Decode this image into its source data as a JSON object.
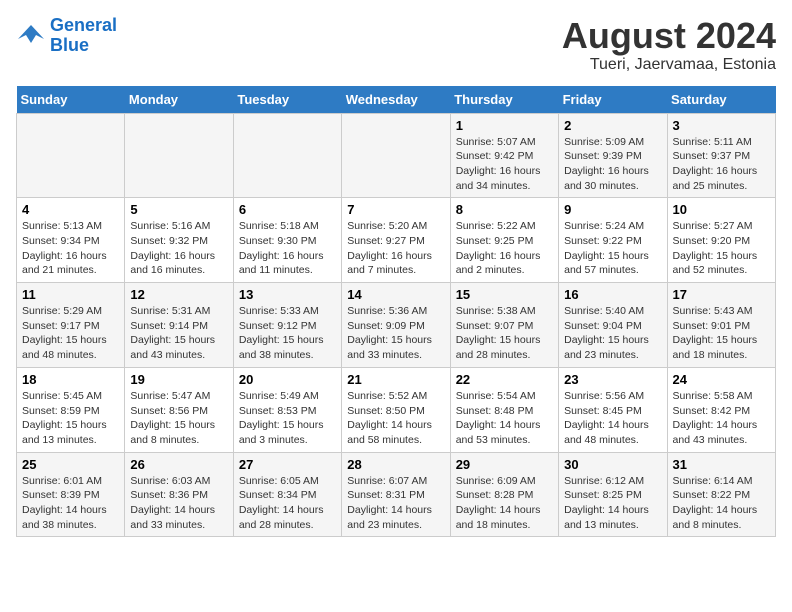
{
  "header": {
    "logo_line1": "General",
    "logo_line2": "Blue",
    "title": "August 2024",
    "subtitle": "Tueri, Jaervamaa, Estonia"
  },
  "weekdays": [
    "Sunday",
    "Monday",
    "Tuesday",
    "Wednesday",
    "Thursday",
    "Friday",
    "Saturday"
  ],
  "weeks": [
    [
      {
        "day": "",
        "info": ""
      },
      {
        "day": "",
        "info": ""
      },
      {
        "day": "",
        "info": ""
      },
      {
        "day": "",
        "info": ""
      },
      {
        "day": "1",
        "info": "Sunrise: 5:07 AM\nSunset: 9:42 PM\nDaylight: 16 hours\nand 34 minutes."
      },
      {
        "day": "2",
        "info": "Sunrise: 5:09 AM\nSunset: 9:39 PM\nDaylight: 16 hours\nand 30 minutes."
      },
      {
        "day": "3",
        "info": "Sunrise: 5:11 AM\nSunset: 9:37 PM\nDaylight: 16 hours\nand 25 minutes."
      }
    ],
    [
      {
        "day": "4",
        "info": "Sunrise: 5:13 AM\nSunset: 9:34 PM\nDaylight: 16 hours\nand 21 minutes."
      },
      {
        "day": "5",
        "info": "Sunrise: 5:16 AM\nSunset: 9:32 PM\nDaylight: 16 hours\nand 16 minutes."
      },
      {
        "day": "6",
        "info": "Sunrise: 5:18 AM\nSunset: 9:30 PM\nDaylight: 16 hours\nand 11 minutes."
      },
      {
        "day": "7",
        "info": "Sunrise: 5:20 AM\nSunset: 9:27 PM\nDaylight: 16 hours\nand 7 minutes."
      },
      {
        "day": "8",
        "info": "Sunrise: 5:22 AM\nSunset: 9:25 PM\nDaylight: 16 hours\nand 2 minutes."
      },
      {
        "day": "9",
        "info": "Sunrise: 5:24 AM\nSunset: 9:22 PM\nDaylight: 15 hours\nand 57 minutes."
      },
      {
        "day": "10",
        "info": "Sunrise: 5:27 AM\nSunset: 9:20 PM\nDaylight: 15 hours\nand 52 minutes."
      }
    ],
    [
      {
        "day": "11",
        "info": "Sunrise: 5:29 AM\nSunset: 9:17 PM\nDaylight: 15 hours\nand 48 minutes."
      },
      {
        "day": "12",
        "info": "Sunrise: 5:31 AM\nSunset: 9:14 PM\nDaylight: 15 hours\nand 43 minutes."
      },
      {
        "day": "13",
        "info": "Sunrise: 5:33 AM\nSunset: 9:12 PM\nDaylight: 15 hours\nand 38 minutes."
      },
      {
        "day": "14",
        "info": "Sunrise: 5:36 AM\nSunset: 9:09 PM\nDaylight: 15 hours\nand 33 minutes."
      },
      {
        "day": "15",
        "info": "Sunrise: 5:38 AM\nSunset: 9:07 PM\nDaylight: 15 hours\nand 28 minutes."
      },
      {
        "day": "16",
        "info": "Sunrise: 5:40 AM\nSunset: 9:04 PM\nDaylight: 15 hours\nand 23 minutes."
      },
      {
        "day": "17",
        "info": "Sunrise: 5:43 AM\nSunset: 9:01 PM\nDaylight: 15 hours\nand 18 minutes."
      }
    ],
    [
      {
        "day": "18",
        "info": "Sunrise: 5:45 AM\nSunset: 8:59 PM\nDaylight: 15 hours\nand 13 minutes."
      },
      {
        "day": "19",
        "info": "Sunrise: 5:47 AM\nSunset: 8:56 PM\nDaylight: 15 hours\nand 8 minutes."
      },
      {
        "day": "20",
        "info": "Sunrise: 5:49 AM\nSunset: 8:53 PM\nDaylight: 15 hours\nand 3 minutes."
      },
      {
        "day": "21",
        "info": "Sunrise: 5:52 AM\nSunset: 8:50 PM\nDaylight: 14 hours\nand 58 minutes."
      },
      {
        "day": "22",
        "info": "Sunrise: 5:54 AM\nSunset: 8:48 PM\nDaylight: 14 hours\nand 53 minutes."
      },
      {
        "day": "23",
        "info": "Sunrise: 5:56 AM\nSunset: 8:45 PM\nDaylight: 14 hours\nand 48 minutes."
      },
      {
        "day": "24",
        "info": "Sunrise: 5:58 AM\nSunset: 8:42 PM\nDaylight: 14 hours\nand 43 minutes."
      }
    ],
    [
      {
        "day": "25",
        "info": "Sunrise: 6:01 AM\nSunset: 8:39 PM\nDaylight: 14 hours\nand 38 minutes."
      },
      {
        "day": "26",
        "info": "Sunrise: 6:03 AM\nSunset: 8:36 PM\nDaylight: 14 hours\nand 33 minutes."
      },
      {
        "day": "27",
        "info": "Sunrise: 6:05 AM\nSunset: 8:34 PM\nDaylight: 14 hours\nand 28 minutes."
      },
      {
        "day": "28",
        "info": "Sunrise: 6:07 AM\nSunset: 8:31 PM\nDaylight: 14 hours\nand 23 minutes."
      },
      {
        "day": "29",
        "info": "Sunrise: 6:09 AM\nSunset: 8:28 PM\nDaylight: 14 hours\nand 18 minutes."
      },
      {
        "day": "30",
        "info": "Sunrise: 6:12 AM\nSunset: 8:25 PM\nDaylight: 14 hours\nand 13 minutes."
      },
      {
        "day": "31",
        "info": "Sunrise: 6:14 AM\nSunset: 8:22 PM\nDaylight: 14 hours\nand 8 minutes."
      }
    ]
  ]
}
